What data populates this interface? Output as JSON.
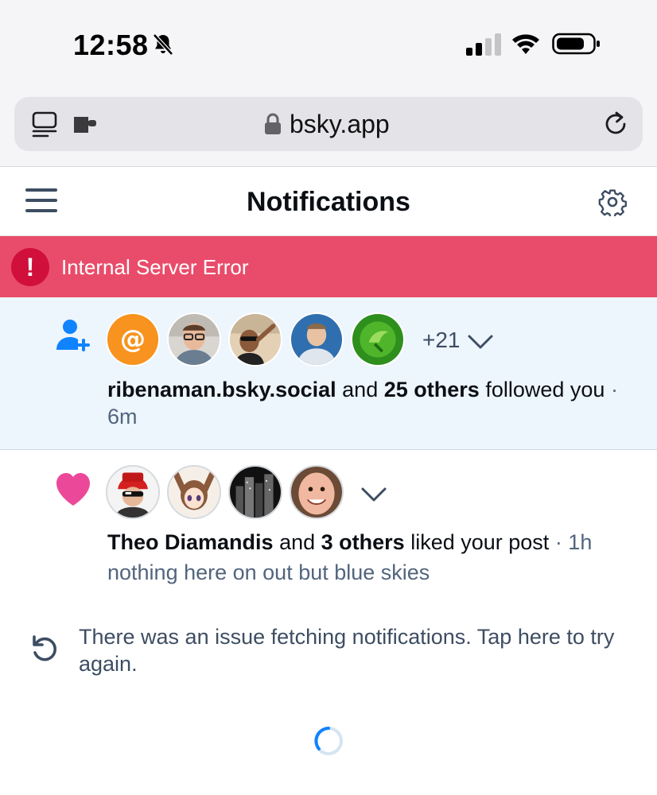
{
  "status_bar": {
    "time": "12:58",
    "icons": [
      "bell-slash-icon",
      "cellular-signal-icon",
      "wifi-icon",
      "battery-icon"
    ]
  },
  "browser": {
    "url": "bsky.app",
    "icons": [
      "sidebar-icon",
      "extension-icon",
      "lock-icon",
      "reload-icon"
    ]
  },
  "header": {
    "title": "Notifications",
    "icons": [
      "hamburger-menu-icon",
      "settings-gear-icon"
    ]
  },
  "error_banner": {
    "icon_glyph": "!",
    "message": "Internal Server Error",
    "color": "#e94c6a"
  },
  "notifications": [
    {
      "type": "follow",
      "type_icon": "user-plus-icon",
      "avatars": [
        "default-at-avatar",
        "man-glasses-avatar",
        "man-sunglasses-beach-avatar",
        "man-blue-background-avatar",
        "green-leaf-avatar"
      ],
      "more_count": "+21",
      "actor": "ribenaman.bsky.social",
      "and": "and",
      "others": "25 others",
      "action": "followed you",
      "time": "· 6m",
      "unread": true
    },
    {
      "type": "like",
      "type_icon": "heart-icon",
      "avatars": [
        "red-hat-avatar",
        "anime-girl-avatar",
        "city-night-avatar",
        "smiling-face-avatar"
      ],
      "actor": "Theo Diamandis",
      "and": "and",
      "others": "3 others",
      "action": "liked your post",
      "time": "· 1h",
      "post_text": "nothing here on out but blue skies",
      "unread": false
    }
  ],
  "retry": {
    "icon": "retry-icon",
    "message": "There was an issue fetching notifications. Tap here to try again."
  },
  "colors": {
    "accent": "#1083fe",
    "heart": "#ec4899",
    "unread_bg": "#edf5fd",
    "text_muted": "#52657d"
  }
}
